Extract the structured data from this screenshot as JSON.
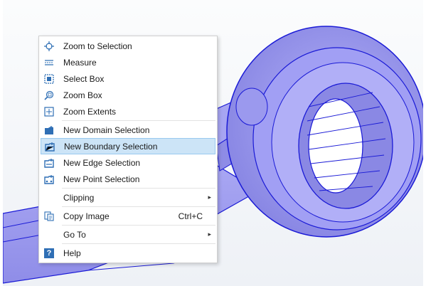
{
  "menu": {
    "items": [
      {
        "label": "Zoom to Selection",
        "icon": "zoom-to-selection-icon"
      },
      {
        "label": "Measure",
        "icon": "measure-icon"
      },
      {
        "label": "Select Box",
        "icon": "select-box-icon"
      },
      {
        "label": "Zoom Box",
        "icon": "zoom-box-icon"
      },
      {
        "label": "Zoom Extents",
        "icon": "zoom-extents-icon"
      },
      {
        "label": "New Domain Selection",
        "icon": "domain-selection-icon"
      },
      {
        "label": "New Boundary Selection",
        "icon": "boundary-selection-icon",
        "highlighted": true
      },
      {
        "label": "New Edge Selection",
        "icon": "edge-selection-icon"
      },
      {
        "label": "New Point Selection",
        "icon": "point-selection-icon"
      },
      {
        "label": "Clipping",
        "submenu_arrow": "▸"
      },
      {
        "label": "Copy Image",
        "icon": "copy-image-icon",
        "shortcut": "Ctrl+C"
      },
      {
        "label": "Go To",
        "submenu_arrow": "▸"
      },
      {
        "label": "Help",
        "icon": "help-icon",
        "icon_text": "?"
      }
    ]
  },
  "colors": {
    "model_fill": "#9a98f0",
    "model_edge": "#1a1ad6",
    "highlight_bg": "#cce4f7",
    "icon_blue": "#2f6fb5"
  }
}
